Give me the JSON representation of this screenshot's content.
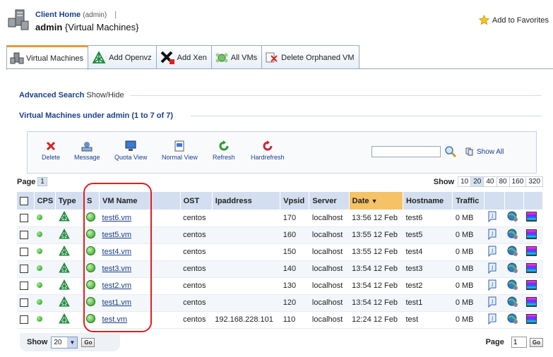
{
  "header": {
    "client_home": "Client Home",
    "client_role": "(admin)",
    "pipe": "|",
    "user": "admin",
    "context": "{Virtual Machines}",
    "favorites": "Add to Favorites"
  },
  "tabs": [
    {
      "label": "Virtual Machines",
      "active": true
    },
    {
      "label": "Add Openvz"
    },
    {
      "label": "Add Xen"
    },
    {
      "label": "All VMs"
    },
    {
      "label": "Delete Orphaned VM"
    }
  ],
  "advanced_search": {
    "link": "Advanced Search",
    "toggle": "Show/Hide"
  },
  "list_title": "Virtual Machines under admin (1 to 7 of 7)",
  "toolbar": {
    "delete": "Delete",
    "message": "Message",
    "quota_view": "Quota View",
    "normal_view": "Normal View",
    "refresh": "Refresh",
    "hardrefresh": "Hardrefresh",
    "show_all": "Show All"
  },
  "pager": {
    "page_label": "Page",
    "current_page": "1",
    "show_label": "Show",
    "sizes": [
      "10",
      "20",
      "40",
      "80",
      "160",
      "320"
    ],
    "selected_size": "20",
    "go": "Go"
  },
  "table": {
    "columns": [
      "CPS",
      "Type",
      "S",
      "VM Name",
      "OST",
      "Ipaddress",
      "Vpsid",
      "Server",
      "Date",
      "Hostname",
      "Traffic"
    ],
    "sorted_column": "Date",
    "rows": [
      {
        "name": "test6.vm",
        "ost": "centos",
        "ip": "",
        "vpsid": "170",
        "server": "localhost",
        "date": "13:56 12 Feb",
        "host": "test6",
        "traffic": "0 MB"
      },
      {
        "name": "test5.vm",
        "ost": "centos",
        "ip": "",
        "vpsid": "160",
        "server": "localhost",
        "date": "13:55 12 Feb",
        "host": "test5",
        "traffic": "0 MB"
      },
      {
        "name": "test4.vm",
        "ost": "centos",
        "ip": "",
        "vpsid": "150",
        "server": "localhost",
        "date": "13:55 12 Feb",
        "host": "test4",
        "traffic": "0 MB"
      },
      {
        "name": "test3.vm",
        "ost": "centos",
        "ip": "",
        "vpsid": "140",
        "server": "localhost",
        "date": "13:54 12 Feb",
        "host": "test3",
        "traffic": "0 MB"
      },
      {
        "name": "test2.vm",
        "ost": "centos",
        "ip": "",
        "vpsid": "130",
        "server": "localhost",
        "date": "13:54 12 Feb",
        "host": "test2",
        "traffic": "0 MB"
      },
      {
        "name": "test1.vm",
        "ost": "centos",
        "ip": "",
        "vpsid": "120",
        "server": "localhost",
        "date": "13:54 12 Feb",
        "host": "test1",
        "traffic": "0 MB"
      },
      {
        "name": "test.vm",
        "ost": "centos",
        "ip": "192.168.228.101",
        "vpsid": "110",
        "server": "localhost",
        "date": "12:24 12 Feb",
        "host": "test",
        "traffic": "0 MB"
      }
    ]
  },
  "bottom": {
    "show_label": "Show",
    "size": "20",
    "go": "Go",
    "page_label": "Page",
    "page_value": "1"
  }
}
